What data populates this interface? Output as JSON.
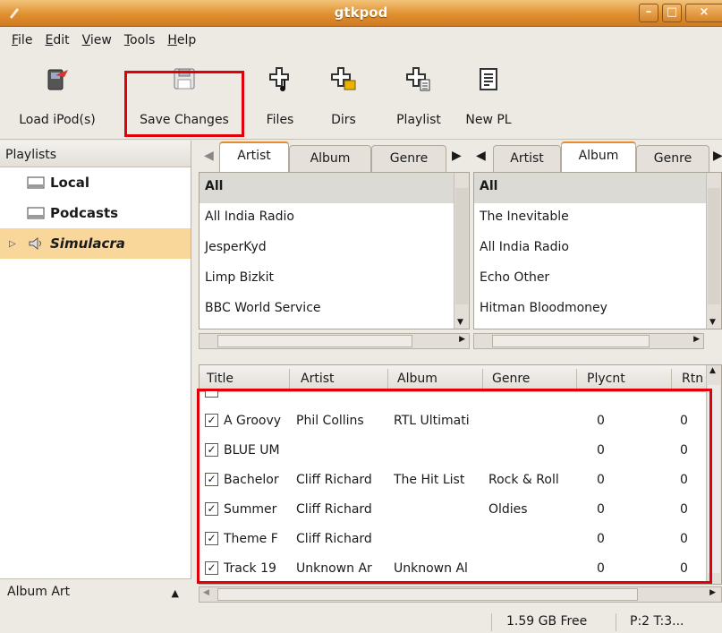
{
  "window": {
    "title": "gtkpod"
  },
  "menu": [
    {
      "label": "File",
      "mnemonic": "F",
      "rest": "ile"
    },
    {
      "label": "Edit",
      "mnemonic": "E",
      "rest": "dit"
    },
    {
      "label": "View",
      "mnemonic": "V",
      "rest": "iew"
    },
    {
      "label": "Tools",
      "mnemonic": "T",
      "rest": "ools"
    },
    {
      "label": "Help",
      "mnemonic": "H",
      "rest": "elp"
    }
  ],
  "toolbar": {
    "load_ipod": "Load iPod(s)",
    "save_changes": "Save Changes",
    "files": "Files",
    "dirs": "Dirs",
    "playlist": "Playlist",
    "new_pl": "New PL"
  },
  "playlists": {
    "header": "Playlists",
    "items": [
      "Local",
      "Podcasts",
      "Simulacra"
    ],
    "footer": "Album Art"
  },
  "sorttab1": {
    "tabs": [
      "Artist",
      "Album",
      "Genre"
    ],
    "active": "Artist",
    "rows": [
      "All",
      "All India Radio",
      "JesperKyd",
      "Limp Bizkit",
      "BBC World Service"
    ]
  },
  "sorttab2": {
    "tabs": [
      "Artist",
      "Album",
      "Genre"
    ],
    "active": "Album",
    "rows": [
      "All",
      "The Inevitable",
      "All India Radio",
      "Echo Other",
      "Hitman Bloodmoney"
    ]
  },
  "tracks": {
    "columns": [
      "Title",
      "Artist",
      "Album",
      "Genre",
      "Plycnt",
      "Rtn"
    ],
    "rows": [
      {
        "title": "A Groovy",
        "artist": "Phil Collins",
        "album": "RTL Ultimati",
        "genre": "",
        "plycnt": "0",
        "rtn": "0"
      },
      {
        "title": "BLUE UM",
        "artist": "",
        "album": "",
        "genre": "",
        "plycnt": "0",
        "rtn": "0"
      },
      {
        "title": "Bachelor",
        "artist": "Cliff Richard",
        "album": "The Hit List",
        "genre": "Rock & Roll",
        "plycnt": "0",
        "rtn": "0"
      },
      {
        "title": "Summer",
        "artist": "Cliff Richard",
        "album": "",
        "genre": "Oldies",
        "plycnt": "0",
        "rtn": "0"
      },
      {
        "title": "Theme F",
        "artist": "Cliff Richard",
        "album": "",
        "genre": "",
        "plycnt": "0",
        "rtn": "0"
      },
      {
        "title": "Track 19",
        "artist": "Unknown Ar",
        "album": "Unknown Al",
        "genre": "",
        "plycnt": "0",
        "rtn": "0"
      }
    ]
  },
  "status": {
    "free": "1.59 GB Free",
    "counts": "P:2 T:3..."
  },
  "colors": {
    "highlight": "#e1000a",
    "accent": "#e68c2e",
    "selection": "#f9d79b"
  }
}
